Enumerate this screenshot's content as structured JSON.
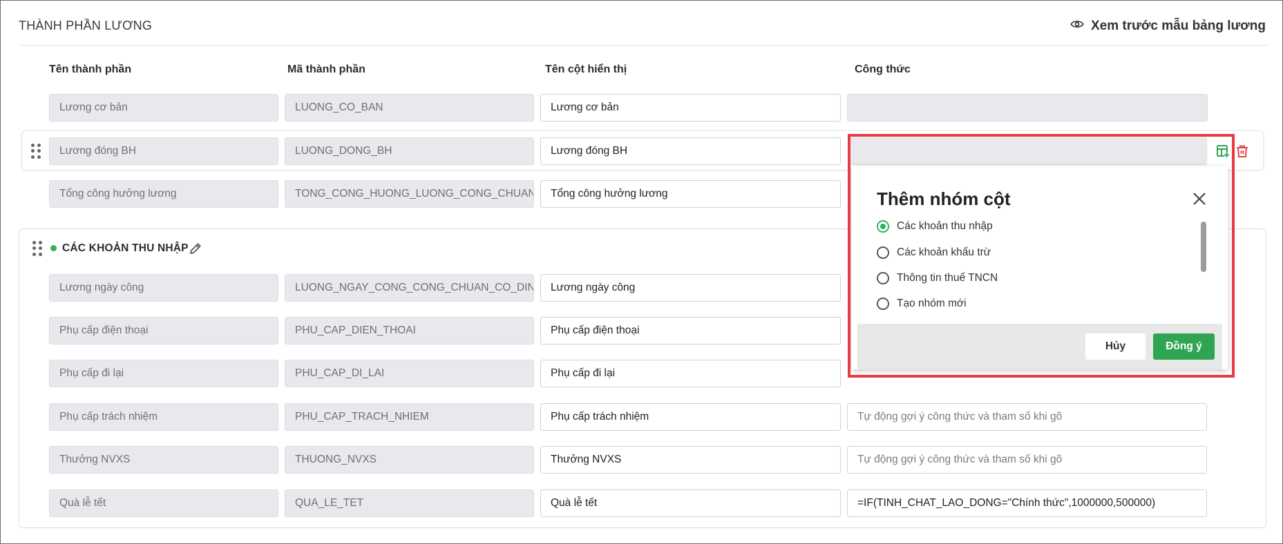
{
  "section": {
    "title": "THÀNH PHẦN LƯƠNG",
    "preview_label": "Xem trước mẫu bảng lương"
  },
  "columns": {
    "name": "Tên thành phần",
    "code": "Mã thành phần",
    "display": "Tên cột hiển thị",
    "formula": "Công thức"
  },
  "top_rows": [
    {
      "name": "Lương cơ bản",
      "code": "LUONG_CO_BAN",
      "display": "Lương cơ bản",
      "formula": ""
    },
    {
      "name": "Lương đóng BH",
      "code": "LUONG_DONG_BH",
      "display": "Lương đóng BH",
      "formula": ""
    },
    {
      "name": "Tổng công hưởng lương",
      "code": "TONG_CONG_HUONG_LUONG_CONG_CHUAN_CO_",
      "display": "Tổng công hưởng lương",
      "formula": ""
    }
  ],
  "group": {
    "title": "CÁC KHOẢN THU NHẬP",
    "rows": [
      {
        "name": "Lương ngày công",
        "code": "LUONG_NGAY_CONG_CONG_CHUAN_CO_DINH",
        "display": "Lương ngày công",
        "formula": ""
      },
      {
        "name": "Phụ cấp điện thoại",
        "code": "PHU_CAP_DIEN_THOAI",
        "display": "Phụ cấp điện thoại",
        "formula": ""
      },
      {
        "name": "Phụ cấp đi lại",
        "code": "PHU_CAP_DI_LAI",
        "display": "Phụ cấp đi lại",
        "formula": ""
      },
      {
        "name": "Phụ cấp trách nhiệm",
        "code": "PHU_CAP_TRACH_NHIEM",
        "display": "Phụ cấp trách nhiệm",
        "formula": "",
        "formula_placeholder": "Tự động gợi ý công thức và tham số khi gõ"
      },
      {
        "name": "Thưởng NVXS",
        "code": "THUONG_NVXS",
        "display": "Thưởng NVXS",
        "formula": "",
        "formula_placeholder": "Tự động gợi ý công thức và tham số khi gõ"
      },
      {
        "name": "Quà lễ tết",
        "code": "QUA_LE_TET",
        "display": "Quà lễ tết",
        "formula": "=IF(TINH_CHAT_LAO_DONG=\"Chính thức\",1000000,500000)"
      }
    ]
  },
  "popup": {
    "title": "Thêm nhóm cột",
    "options": [
      {
        "label": "Các khoản thu nhập",
        "selected": true
      },
      {
        "label": "Các khoản khấu trừ",
        "selected": false
      },
      {
        "label": "Thông tin thuế TNCN",
        "selected": false
      },
      {
        "label": "Tạo nhóm mới",
        "selected": false
      }
    ],
    "cancel_label": "Hủy",
    "ok_label": "Đồng ý"
  },
  "colors": {
    "accent_green": "#2fa552",
    "danger_red": "#e83b46",
    "field_gray": "#e9e9ed"
  },
  "icons": [
    "eye-icon",
    "drag-handle-icon",
    "add-column-group-icon",
    "trash-icon",
    "pencil-icon",
    "close-icon"
  ]
}
